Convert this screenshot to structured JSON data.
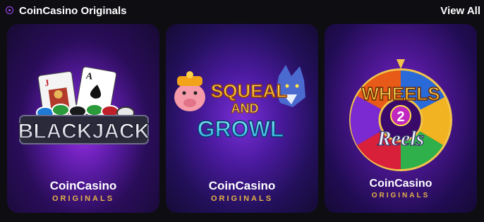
{
  "header": {
    "title": "CoinCasino Originals",
    "view_all": "View All"
  },
  "cards": [
    {
      "game_art_text": "BLACKJACK",
      "brand": "CoinCasino",
      "sub": "ORIGINALS"
    },
    {
      "game_art_text_1": "SQUEAL",
      "game_art_text_2": "AND",
      "game_art_text_3": "GROWL",
      "brand": "CoinCasino",
      "sub": "ORIGINALS"
    },
    {
      "game_art_text_1": "WHEELS",
      "game_art_text_2": "2",
      "game_art_text_3": "Reels",
      "brand": "CoinCasino",
      "sub": "ORIGINALS"
    }
  ],
  "colors": {
    "accent_purple": "#a34cff",
    "gold": "#e5b24a",
    "background": "#0e0d12"
  }
}
